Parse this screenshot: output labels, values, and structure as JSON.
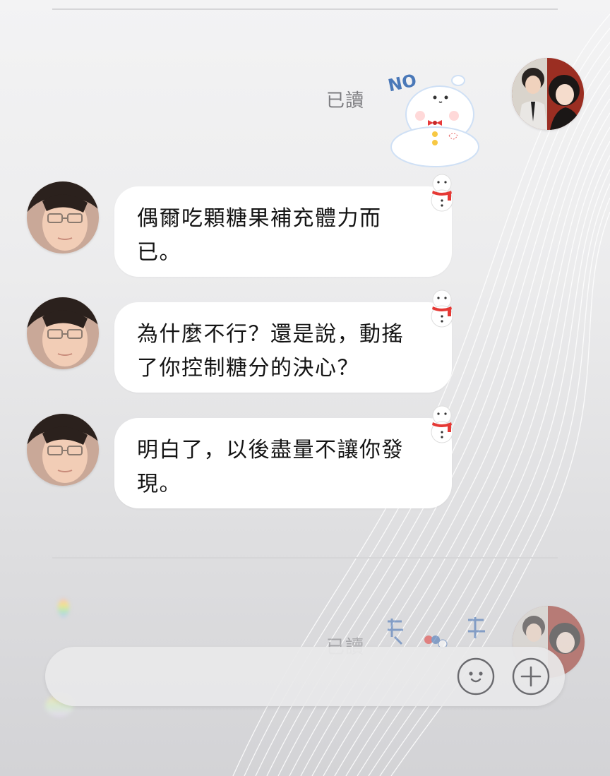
{
  "chat": {
    "messages": [
      {
        "side": "me",
        "type": "sticker",
        "read_status": "已讀",
        "sticker_icon": "snowman-no-sticker",
        "sticker_text": "NO"
      },
      {
        "side": "other",
        "type": "text",
        "text": "偶爾吃顆糖果補充體力而已。"
      },
      {
        "side": "other",
        "type": "text",
        "text": "為什麼不行？還是說，動搖了你控制糖分的決心？"
      },
      {
        "side": "other",
        "type": "text",
        "text": "明白了，以後盡量不讓你發現。"
      },
      {
        "side": "me",
        "type": "sticker",
        "read_status": "已讀",
        "sticker_icon": "cut-off-text-sticker"
      }
    ]
  },
  "input_bar": {
    "emoji_icon": "smiley-face-icon",
    "plus_icon": "plus-circle-icon"
  },
  "colors": {
    "bubble": "#ffffff",
    "read_text": "#7c7c80",
    "background": "#ececed"
  }
}
